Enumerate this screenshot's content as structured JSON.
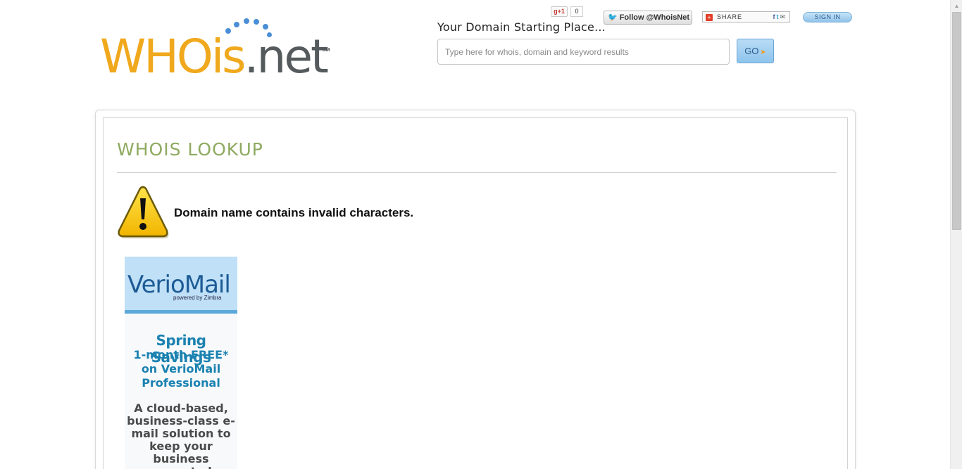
{
  "logo": {
    "who": "WHOis",
    "net": ".net",
    "sm": "SM"
  },
  "header": {
    "tagline": "Your Domain Starting Place...",
    "search_placeholder": "Type here for whois, domain and keyword results",
    "go_label": "GO",
    "gplus_label": "g+1",
    "gplus_count": "0",
    "twitter_label": "Follow @WhoisNet",
    "share_label": "SHARE",
    "signin_label": "SIGN IN"
  },
  "main": {
    "title": "WHOIS LOOKUP",
    "error_message": "Domain name contains invalid characters."
  },
  "ad": {
    "logo_text": "VerioMail",
    "powered_by": "powered by Zimbra",
    "headline": "Spring Savings",
    "offer": "1-month FREE* on VerioMail Professional",
    "body": "A cloud-based, business-class e-mail solution to keep your business connected."
  },
  "colors": {
    "logo_orange": "#f0a81c",
    "logo_gray": "#555a5d",
    "title_green": "#8eaa60",
    "ad_blue": "#1a82b0"
  }
}
